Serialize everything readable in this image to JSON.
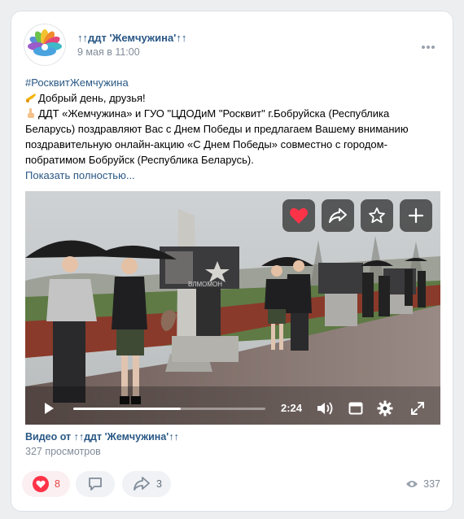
{
  "post": {
    "author": "↑↑ддт 'Жемчужина'↑↑",
    "date": "9 мая в 11:00",
    "hashtag": "#РосквитЖемчужина",
    "greeting": "Добрый день, друзья!",
    "body_lines": [
      "ДДТ «Жемчужина» и ГУО \"ЦДОДиМ \"Росквит\" г.Бобруйска (Республика",
      "Беларусь) поздравляют Вас с Днем Победы и предлагаем Вашему вниманию",
      "поздравительную онлайн-акцию «С Днем Победы» совместно с городом-",
      "побратимом Бобруйск (Республика Беларусь)."
    ],
    "show_more": "Показать полностью..."
  },
  "video": {
    "timecode": "2:24",
    "progress": 0.56,
    "caption": "Видео от ↑↑ддт 'Жемчужина'↑↑",
    "views": "327 просмотров",
    "monument_text": "ВЛМОМОН",
    "overlay_buttons": [
      "heart-icon",
      "share-arrow-icon",
      "star-icon",
      "plus-icon"
    ],
    "control_icons": [
      "play-icon",
      "volume-icon",
      "window-icon",
      "gear-icon",
      "fullscreen-icon"
    ]
  },
  "footer": {
    "likes": "8",
    "shares": "3",
    "view_count": "337"
  },
  "colors": {
    "accent": "#2a5885",
    "like": "#e64646",
    "secondary": "#818c99",
    "background": "#edeef0"
  }
}
